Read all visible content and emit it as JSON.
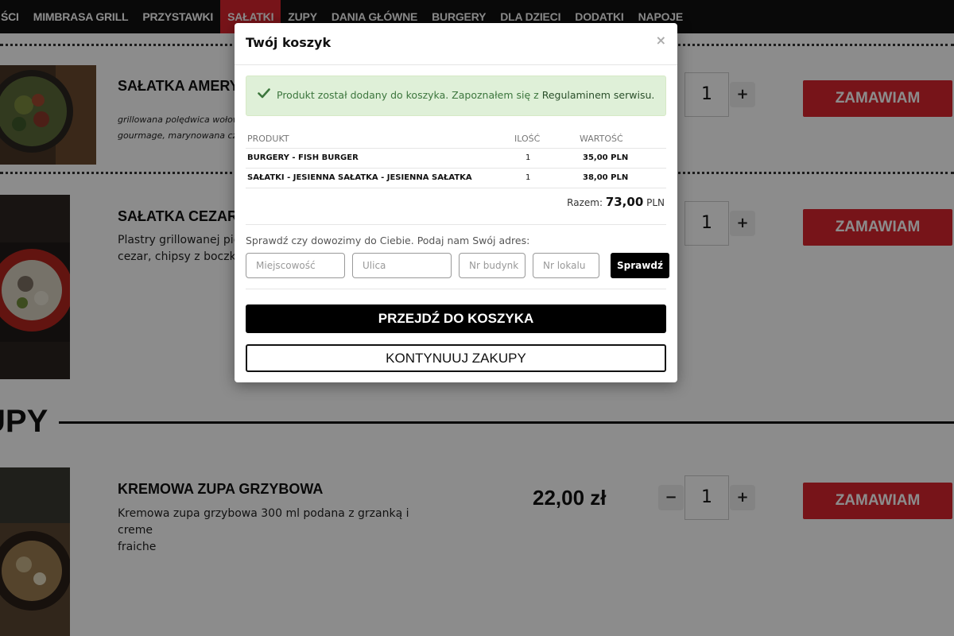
{
  "nav": {
    "items": [
      "ŚCI",
      "MIMBRASA GRILL",
      "PRZYSTAWKI",
      "SAŁATKI",
      "ZUPY",
      "DANIA GŁÓWNE",
      "BURGERY",
      "DLA DZIECI",
      "DODATKI",
      "NAPOJE"
    ],
    "active": "SAŁATKI"
  },
  "dishes": [
    {
      "title": "SAŁATKA AMERYK",
      "desc_line1": "grillowana polędwica wołow",
      "desc_line2": "gourmage, marynowana czer",
      "qty": "1",
      "order_label": "ZAMAWIAM"
    },
    {
      "title": "SAŁATKA CEZAR",
      "desc_line1": "Plastry grillowanej pie",
      "desc_line2": "cezar, chipsy z boczku",
      "qty": "1",
      "order_label": "ZAMAWIAM"
    },
    {
      "title": "KREMOWA ZUPA GRZYBOWA",
      "desc_line1": "Kremowa zupa grzybowa 300 ml podana z grzanką i creme",
      "desc_line2": "fraiche",
      "price": "22,00 zł",
      "qty": "1",
      "minus": "−",
      "plus": "+",
      "order_label": "ZAMAWIAM"
    }
  ],
  "section": {
    "title": "UPY"
  },
  "modal": {
    "title": "Twój koszyk",
    "close": "×",
    "alert_text": "Produkt został dodany do koszyka. Zapoznałem się z ",
    "alert_link": "Regulaminem serwisu.",
    "table": {
      "headers": [
        "PRODUKT",
        "ILOŚĆ",
        "WARTOŚĆ"
      ],
      "rows": [
        {
          "product": "BURGERY - FISH BURGER",
          "qty": "1",
          "value": "35,00 PLN"
        },
        {
          "product": "SAŁATKI - JESIENNA SAŁATKA - JESIENNA SAŁATKA",
          "qty": "1",
          "value": "38,00 PLN"
        }
      ]
    },
    "total_label": "Razem:",
    "total_value": "73,00",
    "total_currency": "PLN",
    "address_label": "Sprawdź czy dowozimy do Ciebie. Podaj nam Swój adres:",
    "placeholders": {
      "city": "Miejscowość",
      "street": "Ulica",
      "building": "Nr budynk",
      "apartment": "Nr lokalu"
    },
    "check_label": "Sprawdź",
    "go_to_cart": "PRZEJDŹ DO KOSZYKA",
    "continue": "KONTYNUUJ ZAKUPY"
  },
  "colors": {
    "accent": "#d9252e",
    "success_bg": "#dff0d8",
    "success_text": "#3c763d"
  }
}
